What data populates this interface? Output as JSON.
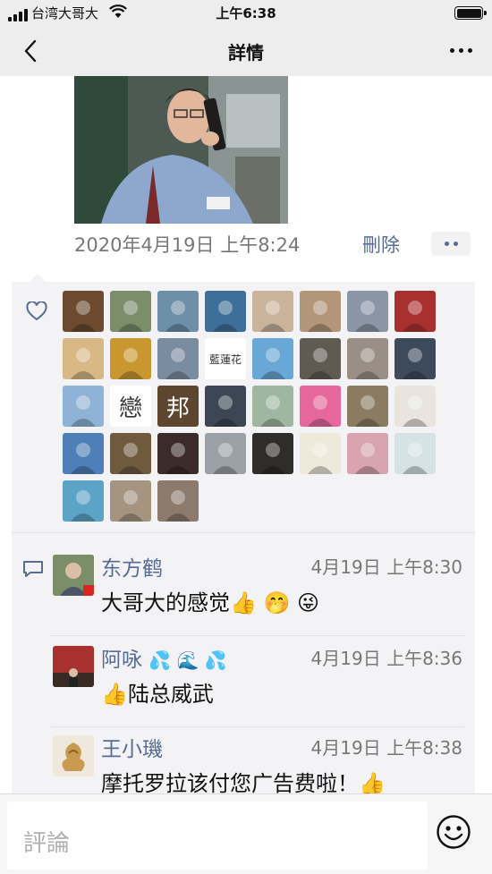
{
  "status_bar": {
    "carrier": "台湾大哥大",
    "time": "上午6:38"
  },
  "nav": {
    "title": "詳情"
  },
  "post": {
    "timestamp": "2020年4月19日 上午8:24",
    "delete_label": "刪除"
  },
  "likes": {
    "avatars": [
      {
        "icon": "avatar-news-collage",
        "color": "#6b4a2e"
      },
      {
        "icon": "avatar-man-portrait",
        "color": "#7c8d6a"
      },
      {
        "icon": "avatar-man-seaside",
        "color": "#6d8fa8"
      },
      {
        "icon": "avatar-teacup-blue",
        "color": "#3e6f9a"
      },
      {
        "icon": "avatar-gift-box",
        "color": "#c9b39a"
      },
      {
        "icon": "avatar-woman-glasses",
        "color": "#b3957a"
      },
      {
        "icon": "avatar-man-suit",
        "color": "#8a96a6"
      },
      {
        "icon": "avatar-red-store",
        "color": "#a8302e"
      },
      {
        "icon": "avatar-golden-phoenix",
        "color": "#d8b985"
      },
      {
        "icon": "avatar-autumn-tree",
        "color": "#c9972f"
      },
      {
        "icon": "avatar-man-landmark",
        "color": "#7a8ca0"
      },
      {
        "icon": "avatar-lotus-logo",
        "color": "#ffffff",
        "text": "藍蓮花"
      },
      {
        "icon": "avatar-beach-girl",
        "color": "#68a7d6"
      },
      {
        "icon": "avatar-man-sitting",
        "color": "#5f5a52"
      },
      {
        "icon": "avatar-man-headphones",
        "color": "#9a8f86"
      },
      {
        "icon": "avatar-woman-sunglasses",
        "color": "#3d4a5c"
      },
      {
        "icon": "avatar-fountain-sky",
        "color": "#8fb3d6"
      },
      {
        "icon": "avatar-calligraphy",
        "color": "#ffffff",
        "text": "戀"
      },
      {
        "icon": "avatar-seal-stamp",
        "color": "#5c4630",
        "text": "邦"
      },
      {
        "icon": "avatar-man-black-suit",
        "color": "#3c4654"
      },
      {
        "icon": "avatar-cyclist",
        "color": "#9fb7a0"
      },
      {
        "icon": "avatar-cartoon-woman",
        "color": "#e5679c"
      },
      {
        "icon": "avatar-pagoda",
        "color": "#8b7b62"
      },
      {
        "icon": "avatar-cartoon-man",
        "color": "#e9e5de"
      },
      {
        "icon": "avatar-bird-sky",
        "color": "#4f7fb8"
      },
      {
        "icon": "avatar-white-flowers",
        "color": "#6f5a3e"
      },
      {
        "icon": "avatar-red-roses",
        "color": "#3b2b2a"
      },
      {
        "icon": "avatar-older-woman",
        "color": "#9aa0a6"
      },
      {
        "icon": "avatar-man-dark",
        "color": "#2e2d2a"
      },
      {
        "icon": "avatar-calligraphy-scroll",
        "color": "#efe9db"
      },
      {
        "icon": "avatar-two-girls",
        "color": "#d8a4b0"
      },
      {
        "icon": "avatar-anime-girl",
        "color": "#d6e3e4"
      },
      {
        "icon": "avatar-lotus-flower",
        "color": "#5ba4c8"
      },
      {
        "icon": "avatar-man-standing",
        "color": "#a49480"
      },
      {
        "icon": "avatar-woman-glasses-2",
        "color": "#8c7a6c"
      }
    ]
  },
  "comments": [
    {
      "name": "东方鹤",
      "name_emoji": "",
      "time": "4月19日 上午8:30",
      "text": "大哥大的感觉",
      "text_emoji_before": "",
      "text_emoji_after": "👍 🤭 😜"
    },
    {
      "name": "阿咏",
      "name_emoji": "💦 🌊 💦",
      "time": "4月19日 上午8:36",
      "text": "陆总威武",
      "text_emoji_before": "👍",
      "text_emoji_after": ""
    },
    {
      "name": "王小璣",
      "name_emoji": "",
      "time": "4月19日 上午8:38",
      "text": "摩托罗拉该付您广告费啦！",
      "text_emoji_before": "",
      "text_emoji_after": "👍"
    }
  ],
  "input": {
    "placeholder": "評論"
  },
  "colors": {
    "link_blue": "#576b95",
    "panel_bg": "#f3f3f5",
    "nav_bg": "#ededed"
  }
}
